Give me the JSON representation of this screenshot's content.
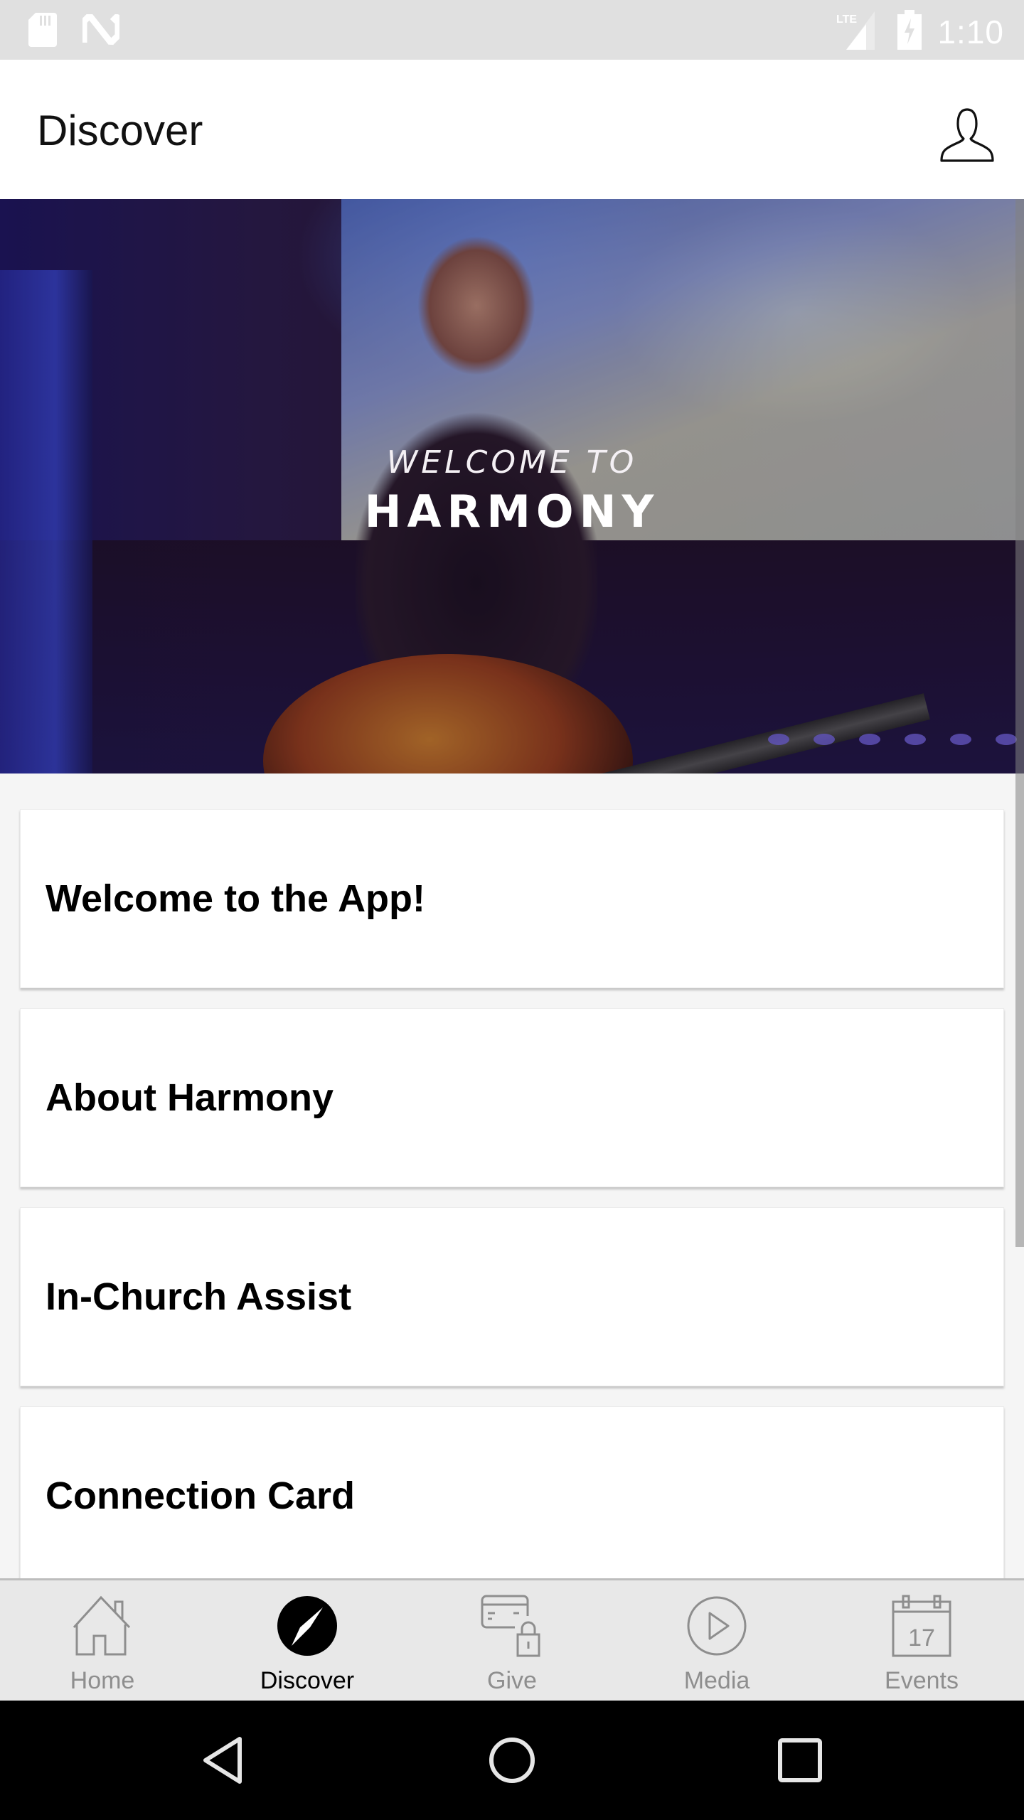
{
  "status_bar": {
    "time": "1:10",
    "network": "LTE",
    "icons": [
      "sd-card-icon",
      "n-notification-icon",
      "lte-signal-icon",
      "battery-charging-icon"
    ]
  },
  "app_bar": {
    "title": "Discover",
    "profile_icon": "user-profile-icon"
  },
  "hero": {
    "line1": "WELCOME TO",
    "line2": "HARMONY"
  },
  "cards": [
    {
      "title": "Welcome to the App!"
    },
    {
      "title": "About Harmony"
    },
    {
      "title": "In-Church Assist"
    },
    {
      "title": "Connection Card"
    }
  ],
  "bottom_nav": {
    "active": "Discover",
    "active_color": "#000000",
    "inactive_color": "#8e8e8e",
    "items": [
      {
        "label": "Home",
        "icon": "home-icon"
      },
      {
        "label": "Discover",
        "icon": "compass-icon"
      },
      {
        "label": "Give",
        "icon": "card-lock-icon"
      },
      {
        "label": "Media",
        "icon": "play-circle-icon"
      },
      {
        "label": "Events",
        "icon": "calendar-icon",
        "calendar_day": "17"
      }
    ]
  },
  "system_nav": {
    "buttons": [
      "back",
      "home",
      "recents"
    ]
  }
}
